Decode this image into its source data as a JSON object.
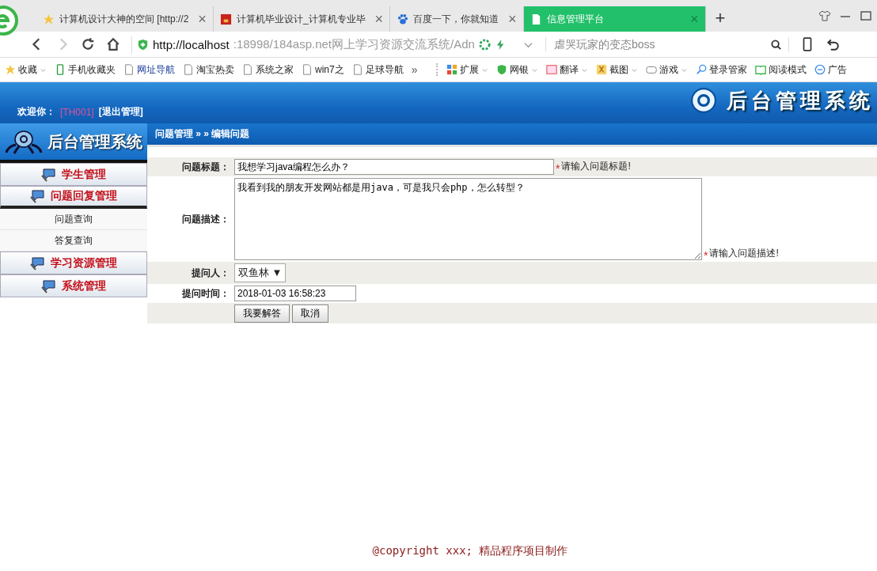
{
  "browser": {
    "tabs": [
      {
        "title": "计算机设计大神的空间 [http://2",
        "close": "×",
        "selected": false
      },
      {
        "title": "计算机毕业设计_计算机专业毕",
        "close": "×",
        "selected": false
      },
      {
        "title": "百度一下，你就知道",
        "close": "×",
        "selected": false
      },
      {
        "title": "信息管理平台",
        "close": "×",
        "selected": true
      }
    ],
    "new_tab": "+",
    "address": {
      "host": "http://localhost",
      "rest": ":18998/184asp.net网上学习资源交流系统/Adn"
    },
    "search": {
      "placeholder": "虐哭玩家的变态boss"
    },
    "bookmarks": [
      {
        "label": "收藏",
        "menu": true
      },
      {
        "label": "手机收藏夹",
        "menu": false
      },
      {
        "label": "网址导航",
        "menu": false
      },
      {
        "label": "淘宝热卖",
        "menu": false
      },
      {
        "label": "系统之家",
        "menu": false
      },
      {
        "label": "win7之",
        "menu": false
      },
      {
        "label": "足球导航",
        "menu": false
      }
    ],
    "more": "»",
    "tools": [
      {
        "label": "扩展",
        "menu": true
      },
      {
        "label": "网银",
        "menu": true
      },
      {
        "label": "翻译",
        "menu": true
      },
      {
        "label": "截图",
        "menu": true
      },
      {
        "label": "游戏",
        "menu": true
      },
      {
        "label": "登录管家",
        "menu": false
      },
      {
        "label": "阅读模式",
        "menu": false
      },
      {
        "label": "广告",
        "menu": false
      }
    ]
  },
  "page": {
    "header": {
      "welcome": "欢迎你：",
      "user": "[TH001]",
      "logout": "[退出管理]",
      "banner_title": "后台管理系统"
    },
    "sidebar": {
      "logo_title": "后台管理系统",
      "menu": [
        {
          "label": "学生管理",
          "expanded": false
        },
        {
          "label": "问题回复管理",
          "expanded": true,
          "children": [
            {
              "label": "问题查询"
            },
            {
              "label": "答复查询"
            }
          ]
        },
        {
          "label": "学习资源管理",
          "expanded": false
        },
        {
          "label": "系统管理",
          "expanded": false
        }
      ]
    },
    "breadcrumb": "问题管理 » » 编辑问题",
    "form": [
      {
        "kind": "input",
        "label": "问题标题：",
        "value": "我想学习java编程怎么办？",
        "required_mark": "*",
        "hint": "请输入问题标题!"
      },
      {
        "kind": "textarea",
        "label": "问题描述：",
        "value": "我看到我的朋友开发网站都是用java，可是我只会php，怎么转型？",
        "required_mark": "*",
        "hint": "请输入问题描述!"
      },
      {
        "kind": "select",
        "label": "提问人：",
        "value": "双鱼林",
        "arrow": "▼"
      },
      {
        "kind": "date",
        "label": "提问时间：",
        "value": "2018-01-03 16:58:23"
      },
      {
        "kind": "buttons",
        "buttons": [
          "我要解答",
          "取消"
        ]
      }
    ],
    "footer": "@copyright xxx; 精品程序项目制作"
  }
}
